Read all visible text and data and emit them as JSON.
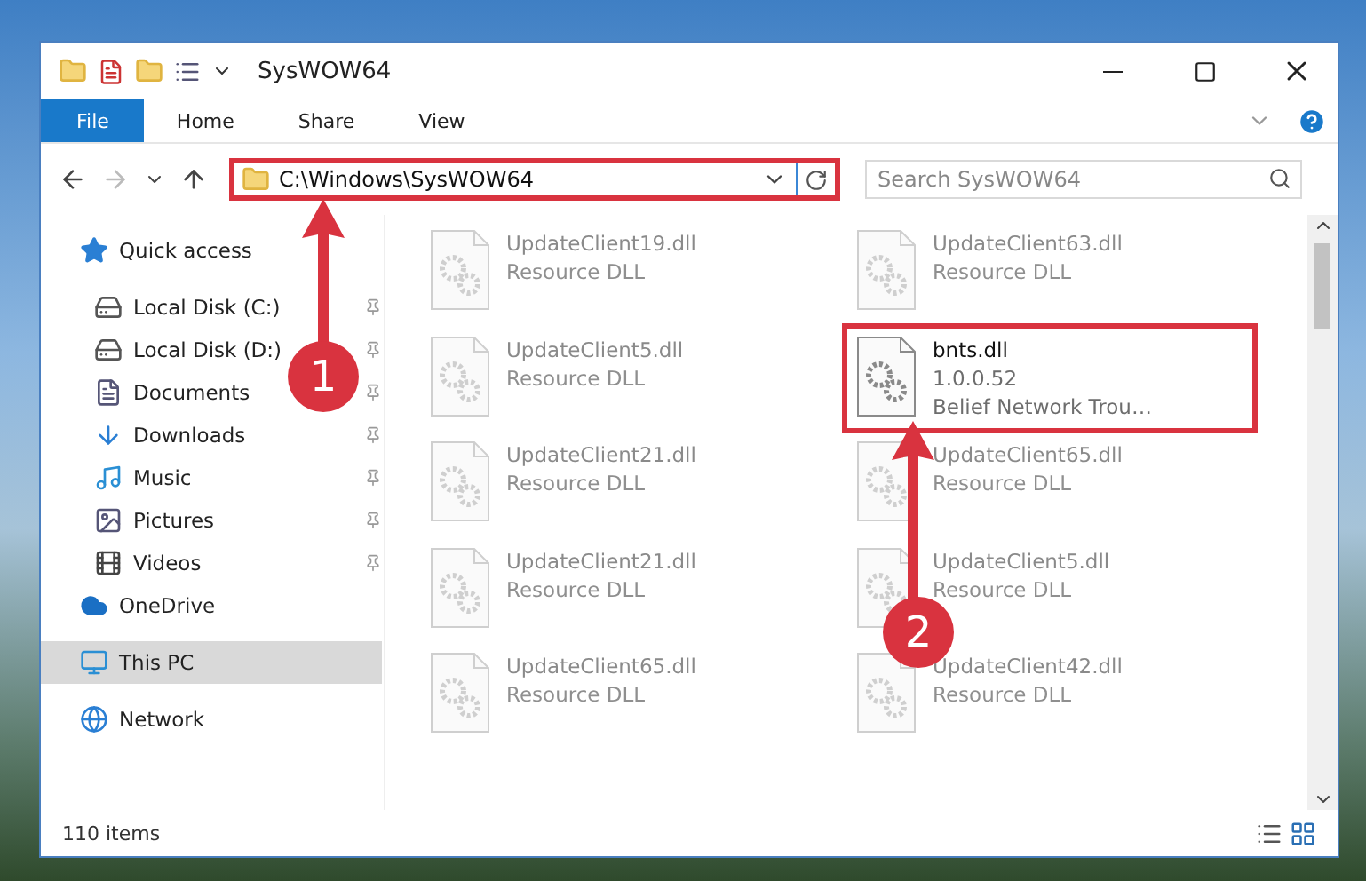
{
  "window": {
    "title": "SysWOW64"
  },
  "ribbon_tabs": [
    {
      "label": "File",
      "selected": true
    },
    {
      "label": "Home",
      "selected": false
    },
    {
      "label": "Share",
      "selected": false
    },
    {
      "label": "View",
      "selected": false
    }
  ],
  "address": {
    "path": "C:\\Windows\\SysWOW64",
    "highlighted": true
  },
  "search": {
    "placeholder": "Search SysWOW64"
  },
  "sidebar": {
    "items": [
      {
        "label": "Quick access",
        "kind": "star",
        "selected": false,
        "children": [
          {
            "label": "Local Disk (C:)",
            "kind": "drive",
            "pinned": true,
            "selected": false
          },
          {
            "label": "Local Disk (D:)",
            "kind": "drive",
            "pinned": true,
            "selected": false
          },
          {
            "label": "Documents",
            "kind": "document",
            "pinned": true,
            "selected": false
          },
          {
            "label": "Downloads",
            "kind": "download",
            "pinned": true,
            "selected": false
          },
          {
            "label": "Music",
            "kind": "music",
            "pinned": true,
            "selected": false
          },
          {
            "label": "Pictures",
            "kind": "picture",
            "pinned": true,
            "selected": false
          },
          {
            "label": "Videos",
            "kind": "video",
            "pinned": true,
            "selected": false
          }
        ]
      },
      {
        "label": "OneDrive",
        "kind": "cloud",
        "selected": false
      },
      {
        "label": "This PC",
        "kind": "pc",
        "selected": true
      },
      {
        "label": "Network",
        "kind": "network",
        "selected": false
      }
    ]
  },
  "files": [
    {
      "name": "UpdateClient19.dll",
      "detail": "Resource DLL",
      "blurred": true,
      "highlighted": false
    },
    {
      "name": "UpdateClient63.dll",
      "detail": "Resource DLL",
      "blurred": true,
      "highlighted": false
    },
    {
      "name": "UpdateClient5.dll",
      "detail": "Resource DLL",
      "blurred": true,
      "highlighted": false
    },
    {
      "name": "bnts.dll",
      "version": "1.0.0.52",
      "detail": "Belief Network Trou…",
      "blurred": false,
      "highlighted": true
    },
    {
      "name": "UpdateClient21.dll",
      "detail": "Resource DLL",
      "blurred": true,
      "highlighted": false
    },
    {
      "name": "UpdateClient65.dll",
      "detail": "Resource DLL",
      "blurred": true,
      "highlighted": false
    },
    {
      "name": "UpdateClient21.dll",
      "detail": "Resource DLL",
      "blurred": true,
      "highlighted": false
    },
    {
      "name": "UpdateClient5.dll",
      "detail": "Resource DLL",
      "blurred": true,
      "highlighted": false
    },
    {
      "name": "UpdateClient65.dll",
      "detail": "Resource DLL",
      "blurred": true,
      "highlighted": false
    },
    {
      "name": "UpdateClient42.dll",
      "detail": "Resource DLL",
      "blurred": true,
      "highlighted": false
    }
  ],
  "status_bar": {
    "item_count": "110 items"
  },
  "callouts": [
    {
      "number": "1"
    },
    {
      "number": "2"
    }
  ]
}
